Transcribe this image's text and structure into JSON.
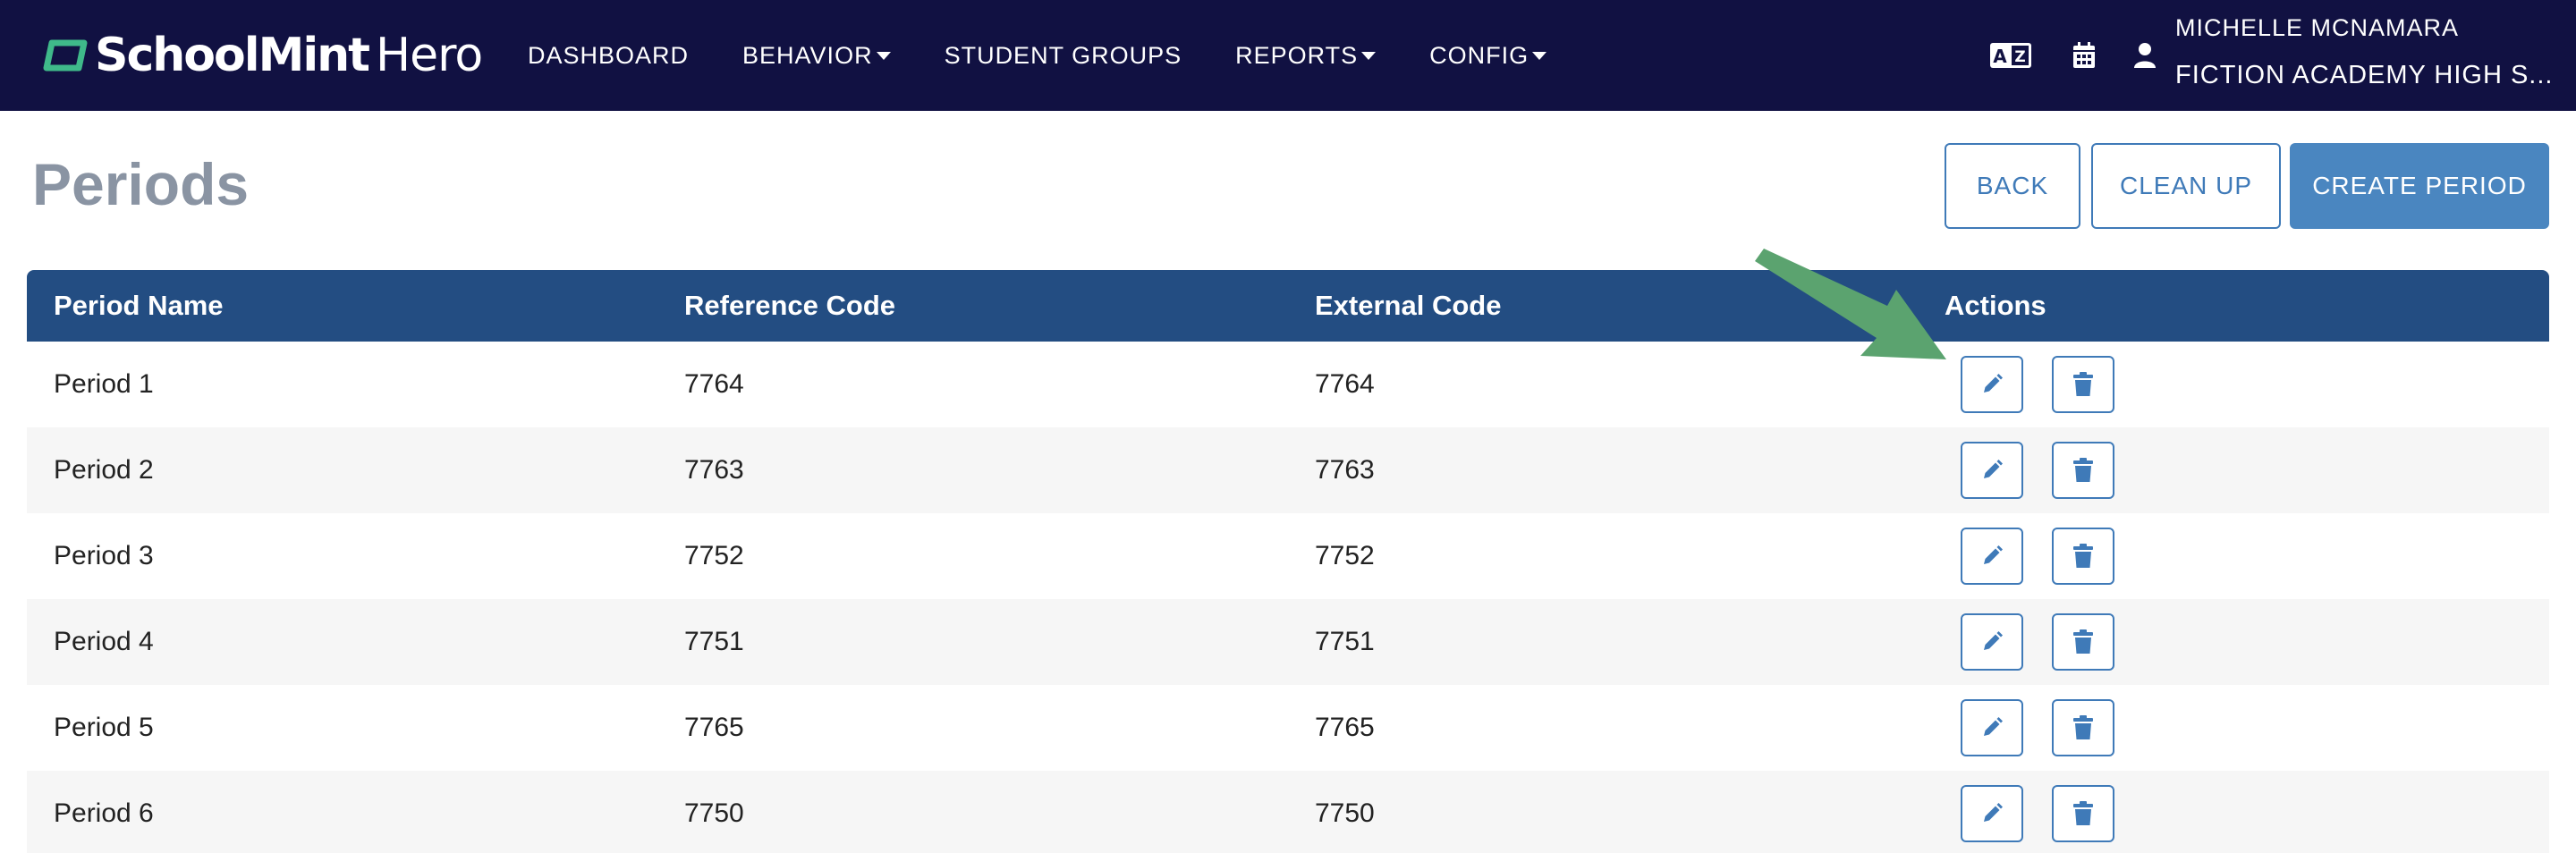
{
  "brand": {
    "school": "SchoolMint",
    "hero": "Hero"
  },
  "nav": {
    "links": [
      {
        "label": "DASHBOARD",
        "dropdown": false
      },
      {
        "label": "BEHAVIOR",
        "dropdown": true
      },
      {
        "label": "STUDENT GROUPS",
        "dropdown": false
      },
      {
        "label": "REPORTS",
        "dropdown": true
      },
      {
        "label": "CONFIG",
        "dropdown": true
      }
    ],
    "icons": [
      "language-icon",
      "calendar-icon",
      "user-icon"
    ],
    "user_name": "MICHELLE MCNAMARA",
    "school_name": "FICTION ACADEMY HIGH S..."
  },
  "page": {
    "title": "Periods",
    "buttons": {
      "back": "BACK",
      "clean_up": "CLEAN UP",
      "create": "CREATE PERIOD"
    }
  },
  "table": {
    "headers": [
      "Period Name",
      "Reference Code",
      "External Code",
      "Actions"
    ],
    "rows": [
      {
        "name": "Period 1",
        "reference": "7764",
        "external": "7764"
      },
      {
        "name": "Period 2",
        "reference": "7763",
        "external": "7763"
      },
      {
        "name": "Period 3",
        "reference": "7752",
        "external": "7752"
      },
      {
        "name": "Period 4",
        "reference": "7751",
        "external": "7751"
      },
      {
        "name": "Period 5",
        "reference": "7765",
        "external": "7765"
      },
      {
        "name": "Period 6",
        "reference": "7750",
        "external": "7750"
      }
    ],
    "action_icons": [
      "pencil-icon",
      "trash-icon"
    ]
  },
  "colors": {
    "navbar": "#111142",
    "table_header": "#234d82",
    "accent": "#4a86c0",
    "title": "#8a94a3",
    "annotation_arrow": "#5ba36f"
  }
}
